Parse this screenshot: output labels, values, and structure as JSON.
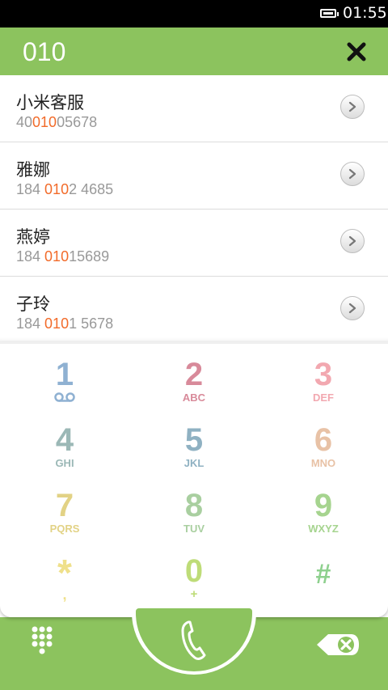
{
  "status_bar": {
    "time": "01:55"
  },
  "header": {
    "query": "010",
    "close_icon": "close-icon"
  },
  "results": [
    {
      "name": "小米客服",
      "number_pre": "40",
      "number_match": "010",
      "number_post": "05678"
    },
    {
      "name": "雅娜",
      "number_pre": "184 ",
      "number_match": "010",
      "number_post": "2 4685"
    },
    {
      "name": "燕婷",
      "number_pre": "184 ",
      "number_match": "010",
      "number_post": "15689"
    },
    {
      "name": "子玲",
      "number_pre": "184 ",
      "number_match": "010",
      "number_post": "1 5678"
    }
  ],
  "keypad": {
    "keys": [
      {
        "digit": "1",
        "letters": "",
        "color": "#8fb1d2"
      },
      {
        "digit": "2",
        "letters": "ABC",
        "color": "#d88a9a"
      },
      {
        "digit": "3",
        "letters": "DEF",
        "color": "#f2a8b0"
      },
      {
        "digit": "4",
        "letters": "GHI",
        "color": "#9bb8b6"
      },
      {
        "digit": "5",
        "letters": "JKL",
        "color": "#8fb1c2"
      },
      {
        "digit": "6",
        "letters": "MNO",
        "color": "#e8c2a6"
      },
      {
        "digit": "7",
        "letters": "PQRS",
        "color": "#e2d285"
      },
      {
        "digit": "8",
        "letters": "TUV",
        "color": "#a9cfa0"
      },
      {
        "digit": "9",
        "letters": "WXYZ",
        "color": "#a6d48f"
      },
      {
        "digit": "*",
        "letters": ",",
        "color": "#efe08a"
      },
      {
        "digit": "0",
        "letters": "+",
        "color": "#bedc78"
      },
      {
        "digit": "#",
        "letters": "",
        "color": "#8ed08e"
      }
    ]
  },
  "colors": {
    "accent": "#8cc35e",
    "match_highlight": "#f26b2a"
  },
  "icons": {
    "voicemail": "voicemail-icon",
    "call": "phone-handset-icon",
    "keypad_toggle": "keypad-grid-icon",
    "delete": "backspace-icon",
    "detail": "chevron-right-icon"
  }
}
